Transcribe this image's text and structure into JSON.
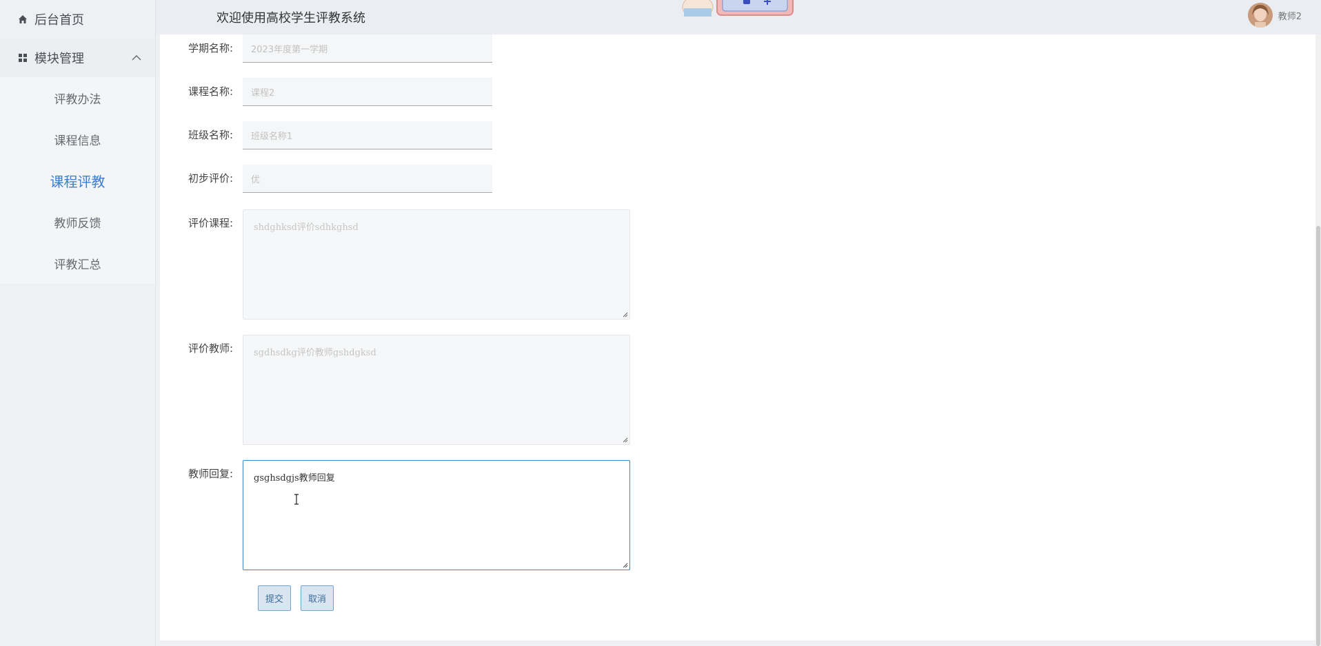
{
  "sidebar": {
    "home_label": "后台首页",
    "group_label": "模块管理",
    "items": [
      {
        "label": "评教办法"
      },
      {
        "label": "课程信息"
      },
      {
        "label": "课程评教"
      },
      {
        "label": "教师反馈"
      },
      {
        "label": "评教汇总"
      }
    ],
    "active_item": "课程评教"
  },
  "header": {
    "title": "欢迎使用高校学生评教系统",
    "username": "教师2"
  },
  "form": {
    "semester": {
      "label": "学期名称:",
      "placeholder": "2023年度第一学期"
    },
    "course": {
      "label": "课程名称:",
      "placeholder": "课程2"
    },
    "class": {
      "label": "班级名称:",
      "placeholder": "班级名称1"
    },
    "initial_eval": {
      "label": "初步评价:",
      "placeholder": "优"
    },
    "eval_course": {
      "label": "评价课程:",
      "value": "shdghksd评价sdhkghsd"
    },
    "eval_teacher": {
      "label": "评价教师:",
      "value": "sgdhsdkg评价教师gshdgksd"
    },
    "teacher_reply": {
      "label": "教师回复:",
      "value": "gsghsdgjs教师回复"
    },
    "submit_label": "提交",
    "cancel_label": "取消"
  },
  "colors": {
    "accent": "#3b7dd6",
    "focus_border": "#3a86c9",
    "button_bg": "#d9e6f1"
  }
}
